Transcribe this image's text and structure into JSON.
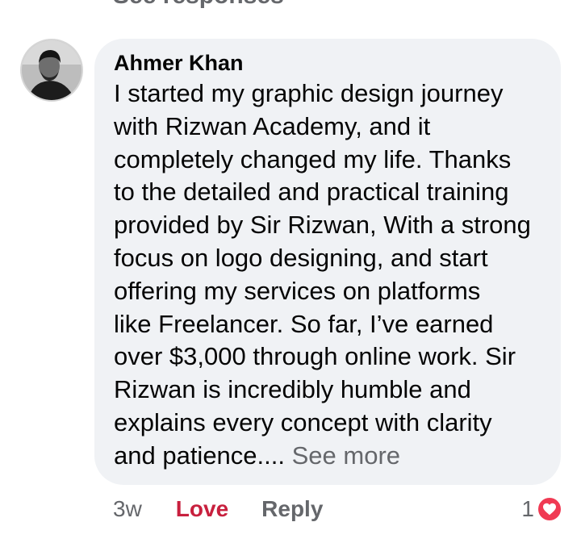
{
  "previous_link": "See responses",
  "comment": {
    "author": "Ahmer Khan",
    "text_lines": [
      "I started my graphic design journey",
      "with Rizwan Academy, and it",
      "completely changed my life. Thanks",
      "to the detailed and practical training",
      "provided by Sir Rizwan, With a strong",
      "focus on logo designing, and start",
      "offering my services on platforms",
      "like Freelancer. So far, I’ve earned",
      "over $3,000 through online work. Sir",
      "Rizwan is incredibly humble and",
      "explains every concept with clarity",
      "and patience.... "
    ],
    "see_more": "See more"
  },
  "actions": {
    "time": "3w",
    "love": "Love",
    "reply": "Reply"
  },
  "reactions": {
    "count": "1",
    "icon": "heart-icon"
  },
  "colors": {
    "bubble_bg": "#f0f2f5",
    "love_red": "#c8203e",
    "muted_gray": "#65676b",
    "heart_badge": "#f03a53"
  }
}
